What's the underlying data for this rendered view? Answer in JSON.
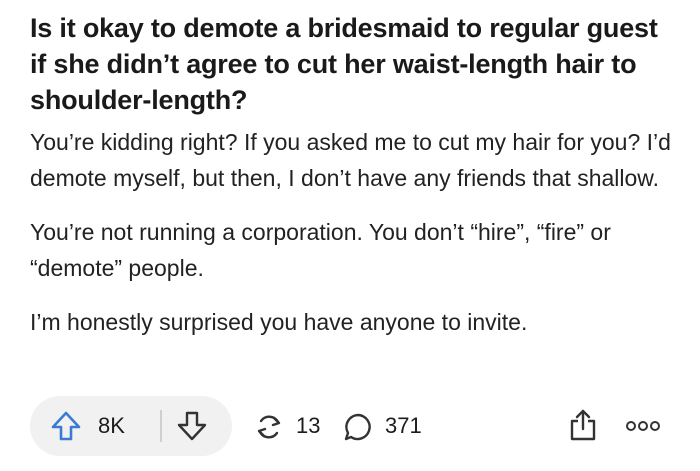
{
  "post": {
    "title": "Is it okay to demote a bridesmaid to regular guest if she didn’t agree to cut her waist-length hair to shoulder-length?",
    "paragraphs": [
      "You’re kidding right? If you asked me to cut my hair for you? I’d demote myself, but then, I don’t have any friends that shallow.",
      "You’re not running a corporation. You don’t “hire”, “fire” or “demote” people.",
      "I’m honestly surprised you have anyone to invite."
    ]
  },
  "actions": {
    "upvotes": "8K",
    "shares": "13",
    "comments": "371",
    "icons": {
      "upvote": "arrow-up-icon",
      "downvote": "arrow-down-icon",
      "share": "share-icon",
      "comment": "comment-bubble-icon",
      "upload": "upload-icon",
      "more": "more-dots-icon"
    },
    "colors": {
      "upvote_accent": "#3a7bd5",
      "pill_background": "#f1f1f1"
    }
  }
}
